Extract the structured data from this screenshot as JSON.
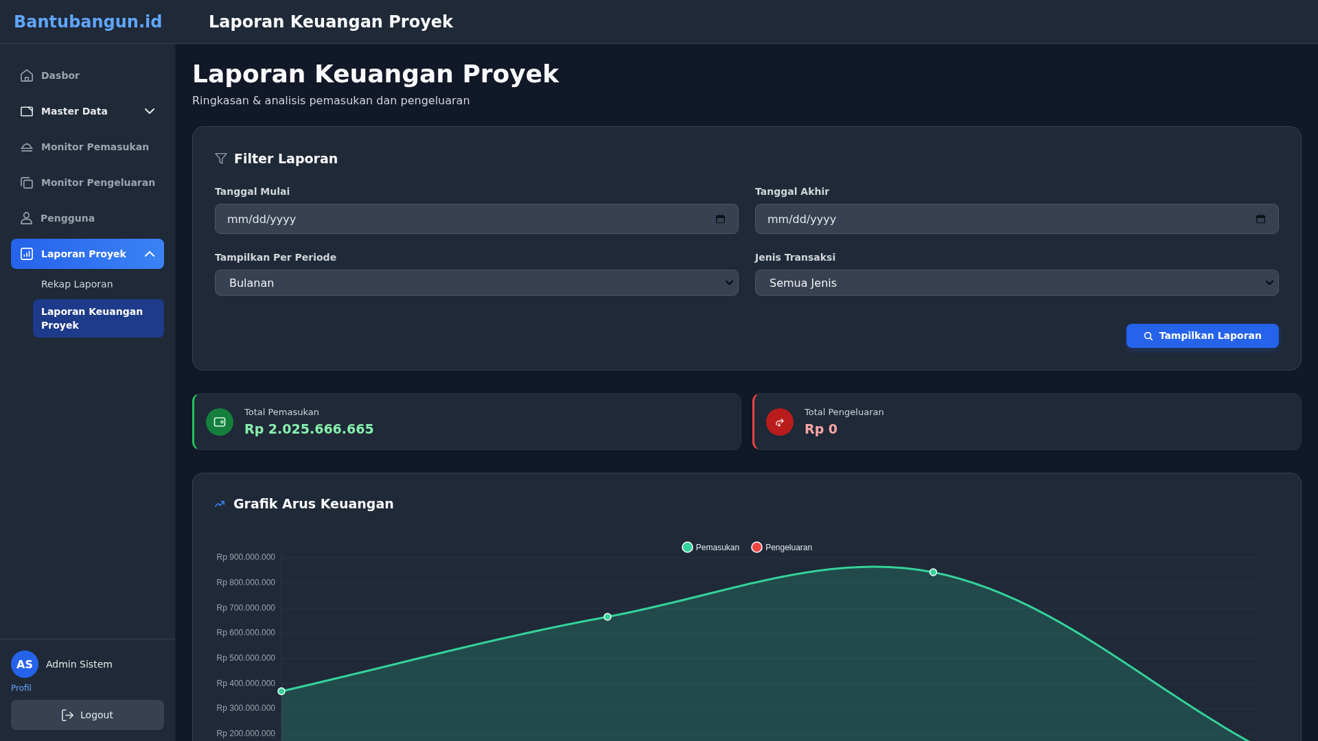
{
  "topbar": {
    "logo": "Bantubangun.id",
    "title": "Laporan Keuangan Proyek"
  },
  "sidebar": {
    "items": [
      {
        "kind": "link",
        "label": "Dasbor",
        "selected": false
      },
      {
        "kind": "group",
        "label": "Master Data",
        "selected": false,
        "expanded": false
      },
      {
        "kind": "link",
        "label": "Monitor Pemasukan",
        "selected": false
      },
      {
        "kind": "link",
        "label": "Monitor Pengeluaran",
        "selected": false
      },
      {
        "kind": "link",
        "label": "Pengguna",
        "selected": false
      },
      {
        "kind": "group",
        "label": "Laporan Proyek",
        "selected": true,
        "expanded": true,
        "children": [
          {
            "label": "Rekap Laporan",
            "selected": false
          },
          {
            "label": "Laporan Keuangan Proyek",
            "selected": true
          }
        ]
      }
    ],
    "user": {
      "initials": "AS",
      "name": "Admin Sistem",
      "profile_link": "Profil"
    },
    "logout_button": "Logout"
  },
  "page": {
    "title": "Laporan Keuangan Proyek",
    "subtitle": "Ringkasan & analisis pemasukan dan pengeluaran"
  },
  "filter": {
    "title": "Filter Laporan",
    "fields": [
      {
        "kind": "date",
        "label": "Tanggal Mulai",
        "placeholder": "mm/dd/yyyy"
      },
      {
        "kind": "date",
        "label": "Tanggal Akhir",
        "placeholder": "mm/dd/yyyy"
      },
      {
        "kind": "select",
        "label": "Tampilkan Per Periode",
        "value": "Bulanan"
      },
      {
        "kind": "select",
        "label": "Jenis Transaksi",
        "value": "Semua Jenis"
      }
    ],
    "button": "Tampilkan Laporan"
  },
  "summary": [
    {
      "kind": "income",
      "label": "Total Pemasukan",
      "value": "Rp 2.025.666.665"
    },
    {
      "kind": "expense",
      "label": "Total Pengeluaran",
      "value": "Rp 0"
    }
  ],
  "chart": {
    "title": "Grafik Arus Keuangan",
    "legend": [
      {
        "name": "Pemasukan",
        "color": "#34d399"
      },
      {
        "name": "Pengeluaran",
        "color": "#ef4444"
      }
    ],
    "y_axis_labels": [
      "Rp 900.000.000",
      "Rp 800.000.000",
      "Rp 700.000.000",
      "Rp 600.000.000",
      "Rp 500.000.000",
      "Rp 400.000.000",
      "Rp 300.000.000",
      "Rp 200.000.000"
    ]
  }
}
